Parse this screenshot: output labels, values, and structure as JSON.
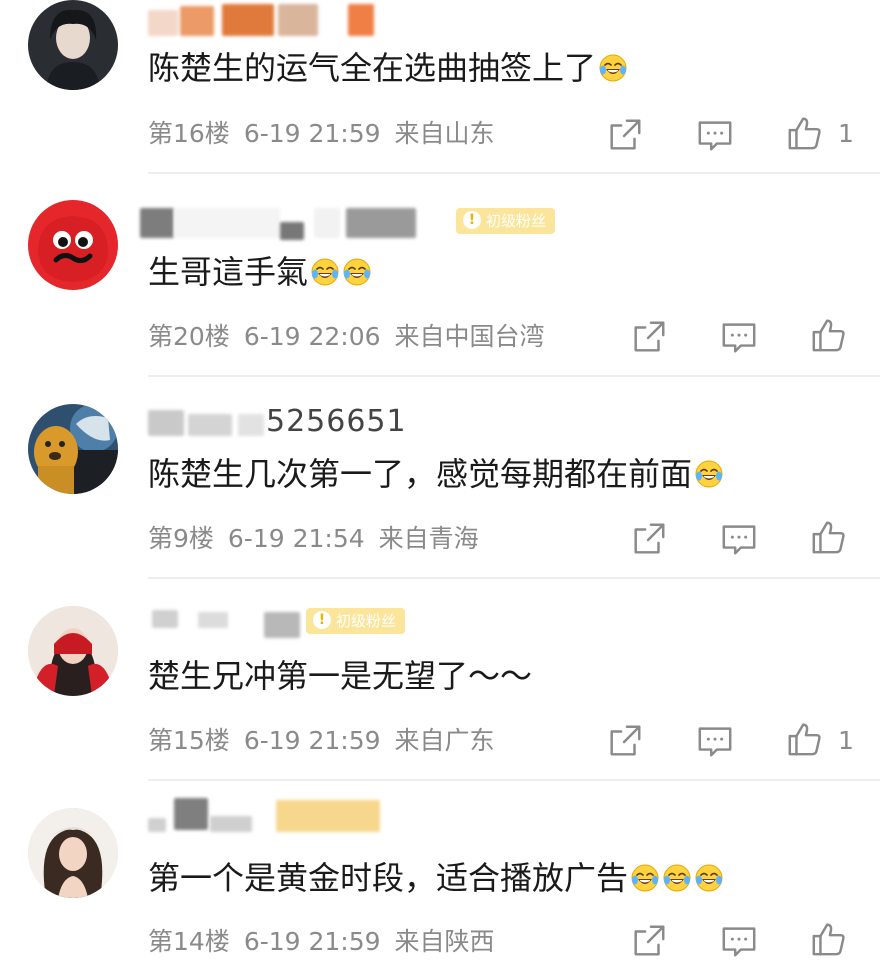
{
  "comments": [
    {
      "username_visible": "",
      "badge": "",
      "text": "陈楚生的运气全在选曲抽签上了",
      "floor": "第16楼",
      "time": "6-19 21:59",
      "location": "来自山东",
      "likes": "1"
    },
    {
      "username_visible": "",
      "badge": "初级粉丝",
      "text": "生哥這手氣",
      "floor": "第20楼",
      "time": "6-19 22:06",
      "location": "来自中国台湾",
      "likes": ""
    },
    {
      "username_visible": "5256651",
      "badge": "",
      "text": "陈楚生几次第一了，感觉每期都在前面",
      "floor": "第9楼",
      "time": "6-19 21:54",
      "location": "来自青海",
      "likes": ""
    },
    {
      "username_visible": "",
      "badge": "初级粉丝",
      "text": "楚生兄冲第一是无望了～～",
      "floor": "第15楼",
      "time": "6-19 21:59",
      "location": "来自广东",
      "likes": "1"
    },
    {
      "username_visible": "",
      "badge": "",
      "text": "第一个是黄金时段，适合播放广告",
      "floor": "第14楼",
      "time": "6-19 21:59",
      "location": "来自陕西",
      "likes": ""
    }
  ],
  "icons": {
    "emoji": "laugh-cry-emoji-icon",
    "share": "share-icon",
    "reply": "comment-icon",
    "like": "thumbs-up-icon"
  },
  "colors": {
    "badge_bg": "#fbe59a",
    "meta_text": "#8a8a8a",
    "text": "#1a1a1a"
  }
}
